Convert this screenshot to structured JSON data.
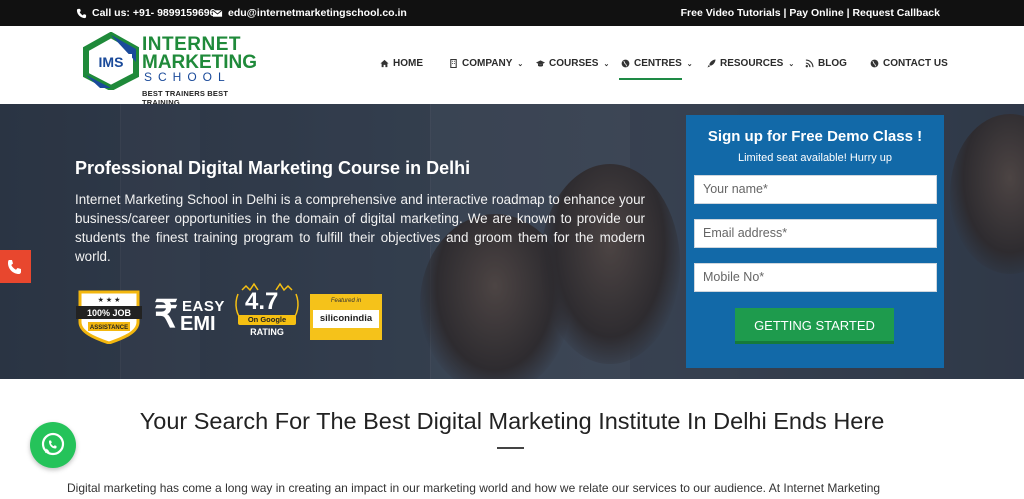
{
  "topbar": {
    "phone": "Call us: +91- 9899159696",
    "email": "edu@internetmarketingschool.co.in",
    "links": [
      "Free Video Tutorials",
      "Pay Online",
      "Request Callback"
    ],
    "separator": " | "
  },
  "logo": {
    "mark": "IMS",
    "line1": "INTERNET",
    "line2": "MARKETING",
    "line3": "SCHOOL",
    "tagline": "BEST TRAINERS BEST TRAINING"
  },
  "nav": {
    "items": [
      {
        "label": "HOME",
        "icon": "home-icon"
      },
      {
        "label": "COMPANY",
        "icon": "building-icon",
        "caret": "⌄"
      },
      {
        "label": "COURSES",
        "icon": "graduation-cap-icon",
        "caret": "⌄"
      },
      {
        "label": "CENTRES",
        "icon": "globe-icon",
        "caret": "⌄"
      },
      {
        "label": "RESOURCES",
        "icon": "rocket-icon",
        "caret": "⌄"
      },
      {
        "label": "BLOG",
        "icon": "rss-icon"
      },
      {
        "label": "CONTACT US",
        "icon": "globe-icon"
      }
    ],
    "active": "CENTRES"
  },
  "hero": {
    "title": "Professional Digital Marketing Course in Delhi",
    "text": "Internet Marketing School in Delhi is a comprehensive and interactive roadmap to enhance your business/career opportunities in the domain of digital marketing. We are known to provide our students the finest training program to fulfill their objectives and groom them for the modern world.",
    "badges": {
      "job": {
        "stars": "★ ★ ★",
        "line1": "100% JOB",
        "line2": "ASSISTANCE"
      },
      "emi": {
        "symbol": "₹",
        "line1": "EASY",
        "line2": "EMI"
      },
      "rating": {
        "value": "4.7",
        "source": "On Google",
        "label": "RATING"
      },
      "featured": {
        "label": "Featured in",
        "brand": "siliconindia"
      }
    }
  },
  "form": {
    "title": "Sign up for Free Demo Class !",
    "subtitle": "Limited seat available! Hurry up",
    "name_placeholder": "Your name*",
    "email_placeholder": "Email address*",
    "mobile_placeholder": "Mobile No*",
    "button": "GETTING STARTED"
  },
  "section": {
    "title": "Your Search For The Best Digital Marketing Institute In Delhi Ends Here",
    "intro": "Digital marketing has come a long way in creating an impact in our marketing world and how we relate our services to our audience. At Internet Marketing"
  },
  "colors": {
    "topbar": "#111111",
    "brand_green": "#1f8a3a",
    "form_blue": "#1269a8",
    "button_green": "#1e9b4d",
    "phone_tab": "#e8472e",
    "whatsapp": "#25c35a"
  }
}
